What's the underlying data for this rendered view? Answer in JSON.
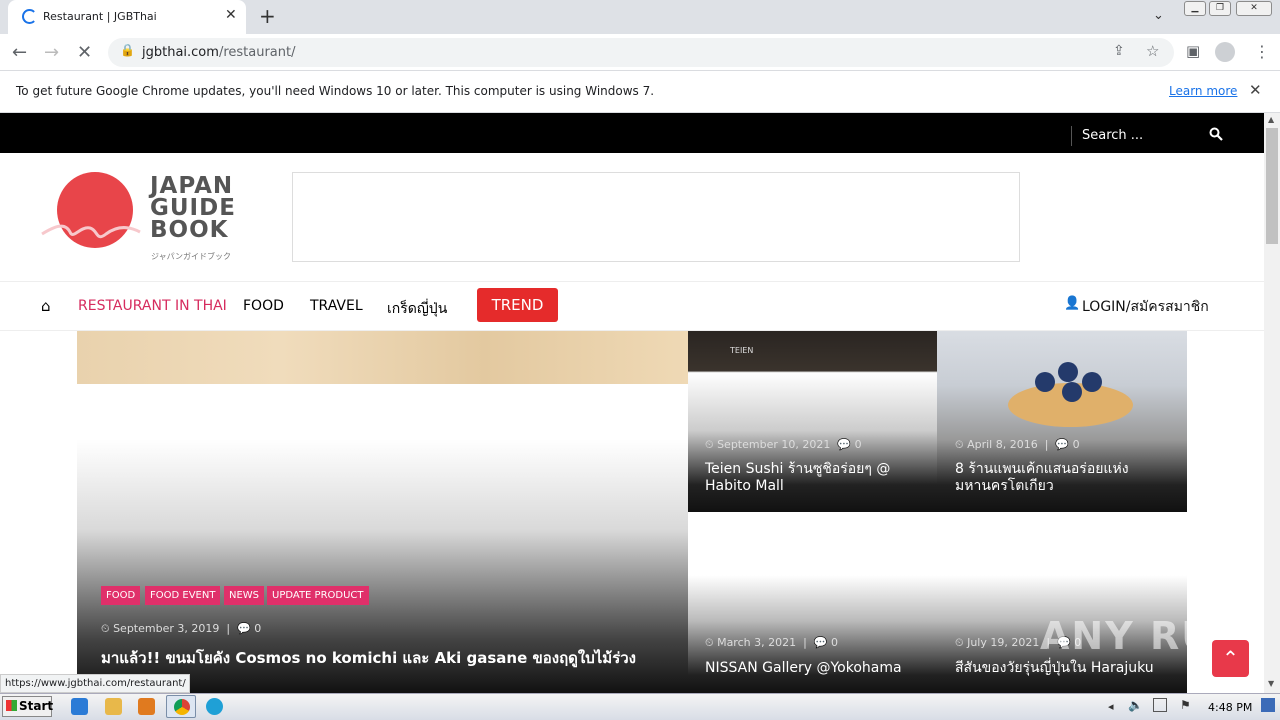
{
  "browser": {
    "tab_title": "Restaurant | JGBThai",
    "url_domain": "jgbthai.com",
    "url_path": "/restaurant/",
    "infobar_message": "To get future Google Chrome updates, you'll need Windows 10 or later. This computer is using Windows 7.",
    "infobar_link": "Learn more",
    "status_url": "https://www.jgbthai.com/restaurant/"
  },
  "site": {
    "search_placeholder": "Search ...",
    "logo_line1": "JAPAN",
    "logo_line2": "GUIDE",
    "logo_line3": "BOOK",
    "logo_sub": "ジャパンガイドブック",
    "nav": {
      "restaurant": "RESTAURANT IN THAI",
      "food": "FOOD",
      "travel": "TRAVEL",
      "trivia": "เกร็ดญี่ปุ่น",
      "trend": "TREND",
      "login": "LOGIN/สมัครสมาชิก"
    }
  },
  "posts": {
    "main": {
      "categories": [
        "FOOD",
        "FOOD EVENT",
        "NEWS",
        "UPDATE PRODUCT"
      ],
      "date": "September 3, 2019",
      "comments": "0",
      "title": "มาแล้ว!! ขนมโยคัง Cosmos no komichi และ Aki gasane ของฤดูใบไม้ร่วง"
    },
    "card1": {
      "date": "September 10, 2021",
      "comments": "0",
      "title": "Teien Sushi ร้านซูชิอร่อยๆ @ Habito Mall",
      "sign": "TEIEN"
    },
    "card2": {
      "date": "April 8, 2016",
      "comments": "0",
      "title": "8 ร้านแพนเค้กแสนอร่อยแห่งมหานครโตเกียว"
    },
    "card3": {
      "date": "March 3, 2021",
      "comments": "0",
      "title": "NISSAN Gallery @Yokohama"
    },
    "card4": {
      "date": "July 19, 2021",
      "comments": "0",
      "title": "สีสันของวัยรุ่นญี่ปุ่นใน Harajuku"
    }
  },
  "watermark": "ANY RUN",
  "taskbar": {
    "start": "Start",
    "time": "4:48 PM"
  }
}
